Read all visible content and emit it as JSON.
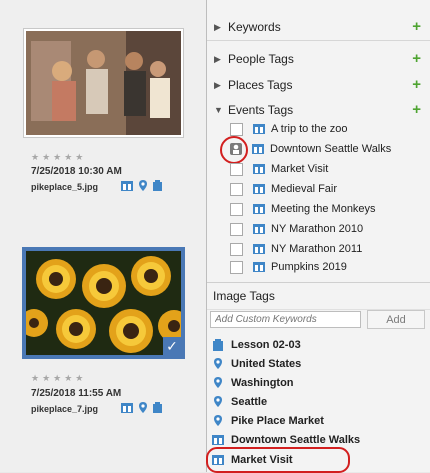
{
  "photos": [
    {
      "stars": "★★★★★",
      "date": "7/25/2018 10:30 AM",
      "filename": "pikeplace_5.jpg",
      "icons": [
        "event-icon",
        "place-pin-icon",
        "album-icon"
      ]
    },
    {
      "stars": "★★★★★",
      "date": "7/25/2018 11:55 AM",
      "filename": "pikeplace_7.jpg",
      "icons": [
        "event-icon",
        "place-pin-icon",
        "album-icon"
      ],
      "selected": true
    }
  ],
  "panel": {
    "sections": [
      {
        "label": "Keywords",
        "collapsed": true
      },
      {
        "label": "People Tags",
        "collapsed": true
      },
      {
        "label": "Places Tags",
        "collapsed": true
      },
      {
        "label": "Events Tags",
        "collapsed": false
      }
    ],
    "events": [
      "A trip to the zoo",
      "Downtown Seattle Walks",
      "Market Visit",
      "Medieval Fair",
      "Meeting the Monkeys",
      "NY Marathon 2010",
      "NY Marathon 2011",
      "Pumpkins 2019"
    ],
    "image_tags_title": "Image Tags",
    "keyword_placeholder": "Add Custom Keywords",
    "add_label": "Add",
    "image_tags": [
      {
        "label": "Lesson 02-03",
        "icon": "album-icon"
      },
      {
        "label": "United States",
        "icon": "place-pin-icon"
      },
      {
        "label": "Washington",
        "icon": "place-pin-icon"
      },
      {
        "label": "Seattle",
        "icon": "place-pin-icon"
      },
      {
        "label": "Pike Place Market",
        "icon": "place-pin-icon"
      },
      {
        "label": "Downtown Seattle Walks",
        "icon": "event-icon"
      },
      {
        "label": "Market Visit",
        "icon": "event-icon"
      }
    ]
  },
  "colors": {
    "accent": "#4a78b5",
    "plus_green": "#4ea431",
    "highlight_red": "#d21f1f",
    "event_icon_blue": "#3f86c7"
  }
}
